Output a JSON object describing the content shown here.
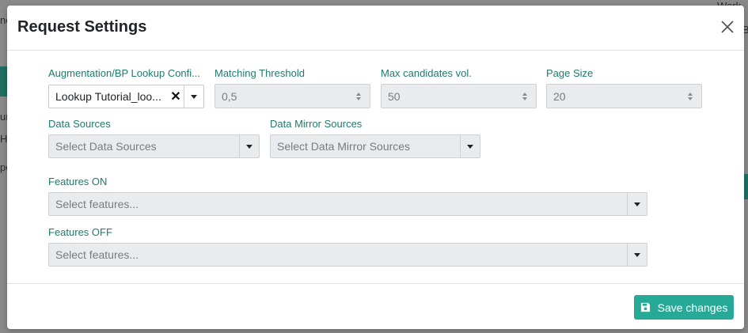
{
  "background": {
    "fragments": [
      "ne",
      "Work",
      "Ba",
      "un",
      "H",
      "pe"
    ]
  },
  "modal": {
    "title": "Request Settings",
    "close_icon": "close-icon",
    "fields": {
      "augmentation": {
        "label": "Augmentation/BP Lookup Confi...",
        "value": "Lookup Tutorial_loo..."
      },
      "matching_threshold": {
        "label": "Matching Threshold",
        "value": "0,5"
      },
      "max_candidates": {
        "label": "Max candidates vol.",
        "value": "50"
      },
      "page_size": {
        "label": "Page Size",
        "value": "20"
      },
      "data_sources": {
        "label": "Data Sources",
        "placeholder": "Select Data Sources"
      },
      "data_mirror_sources": {
        "label": "Data Mirror Sources",
        "placeholder": "Select Data Mirror Sources"
      },
      "features_on": {
        "label": "Features ON",
        "placeholder": "Select features..."
      },
      "features_off": {
        "label": "Features OFF",
        "placeholder": "Select features..."
      }
    },
    "footer": {
      "save_label": "Save changes",
      "save_icon": "floppy-disk-icon"
    }
  },
  "colors": {
    "accent": "#26a996",
    "label": "#1f7a6e",
    "disabled_bg": "#e9ecef"
  }
}
